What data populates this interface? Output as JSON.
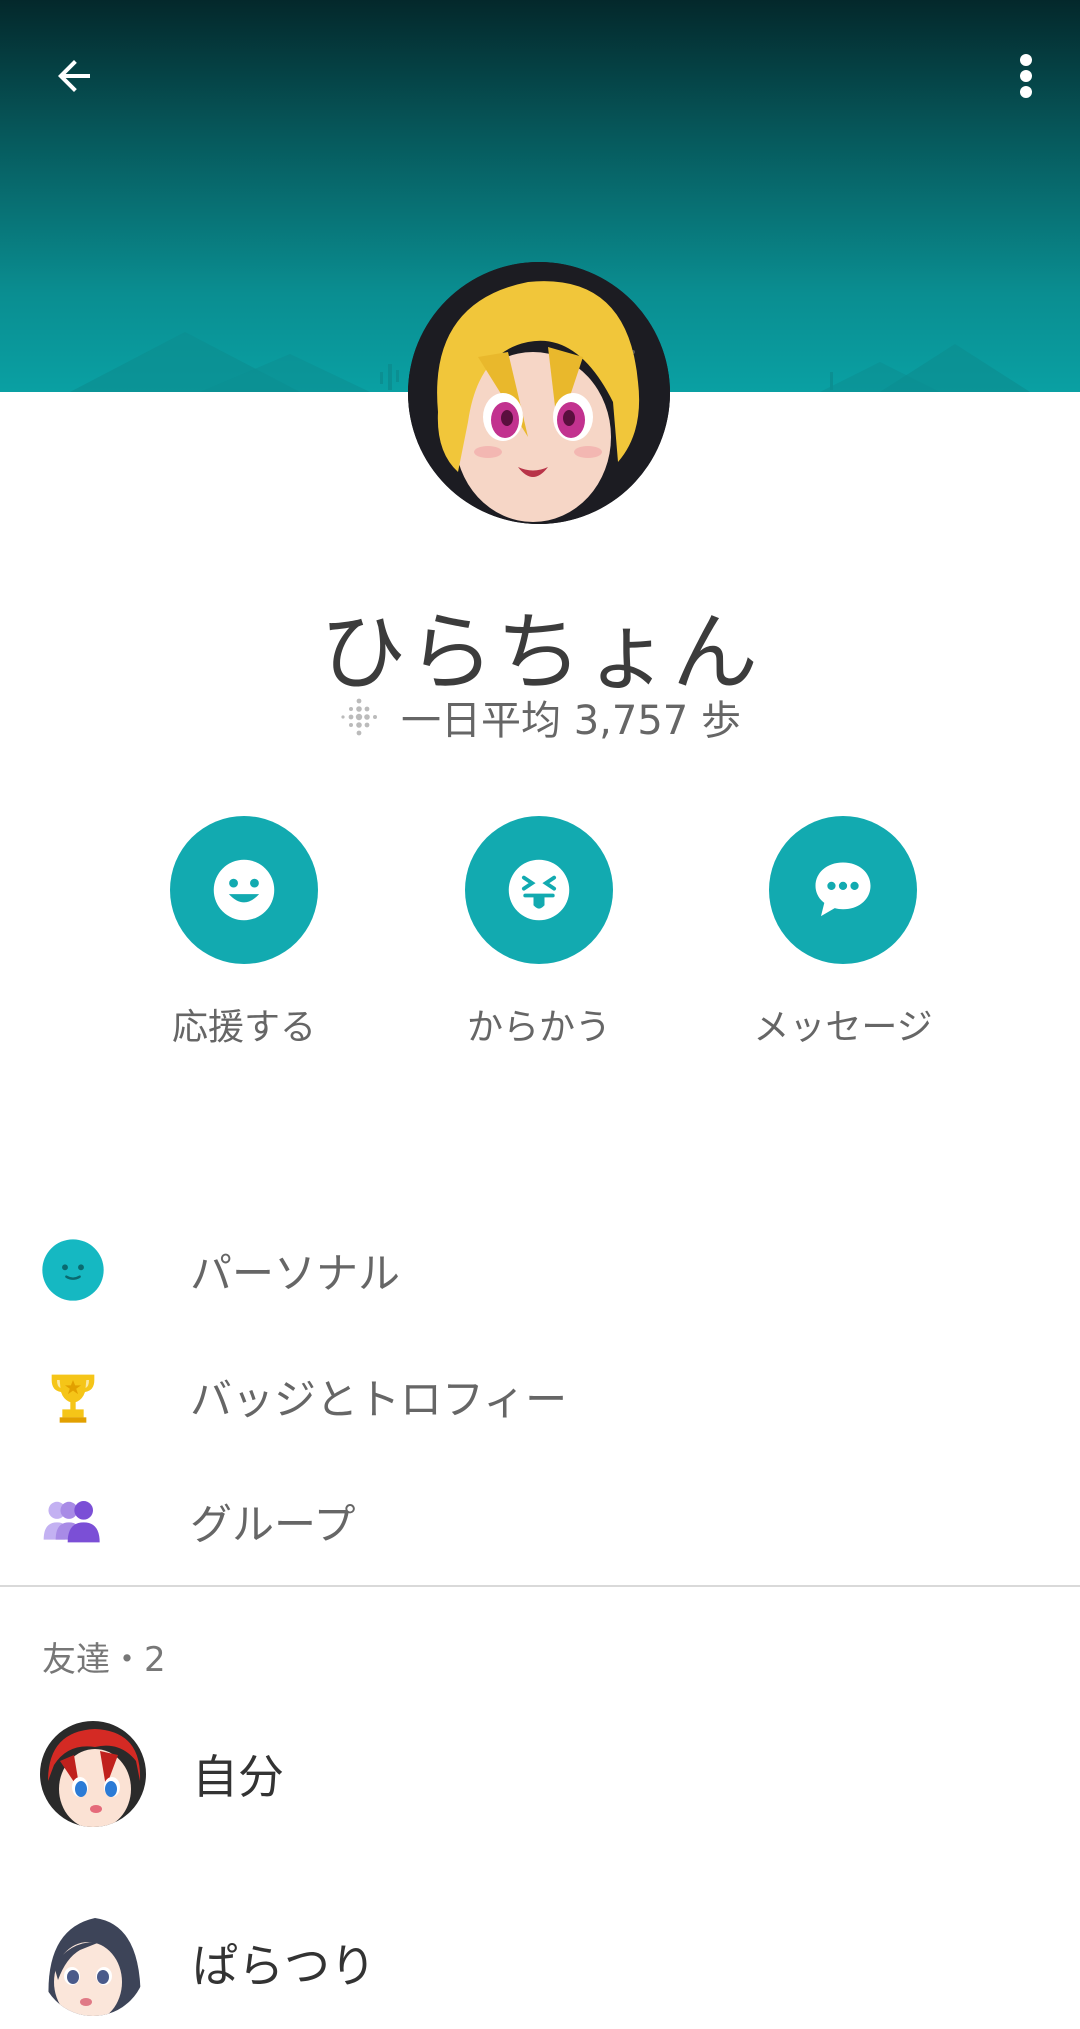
{
  "header": {
    "back_icon": "arrow-left-icon",
    "more_icon": "more-vert-icon"
  },
  "profile": {
    "name": "ひらちょん",
    "steps_text": "一日平均 3,757 歩"
  },
  "actions": [
    {
      "label": "応援する",
      "icon": "smile-icon"
    },
    {
      "label": "からかう",
      "icon": "tongue-face-icon"
    },
    {
      "label": "メッセージ",
      "icon": "chat-bubble-icon"
    }
  ],
  "menu": [
    {
      "label": "パーソナル",
      "icon": "personal-face-icon"
    },
    {
      "label": "バッジとトロフィー",
      "icon": "trophy-icon"
    },
    {
      "label": "グループ",
      "icon": "group-icon"
    }
  ],
  "friends": {
    "header": "友達・2",
    "items": [
      {
        "name": "自分"
      },
      {
        "name": "ぱらつり"
      }
    ]
  },
  "colors": {
    "accent": "#12aab0",
    "banner_dark": "#04282b",
    "banner_light": "#0aa0a3"
  }
}
